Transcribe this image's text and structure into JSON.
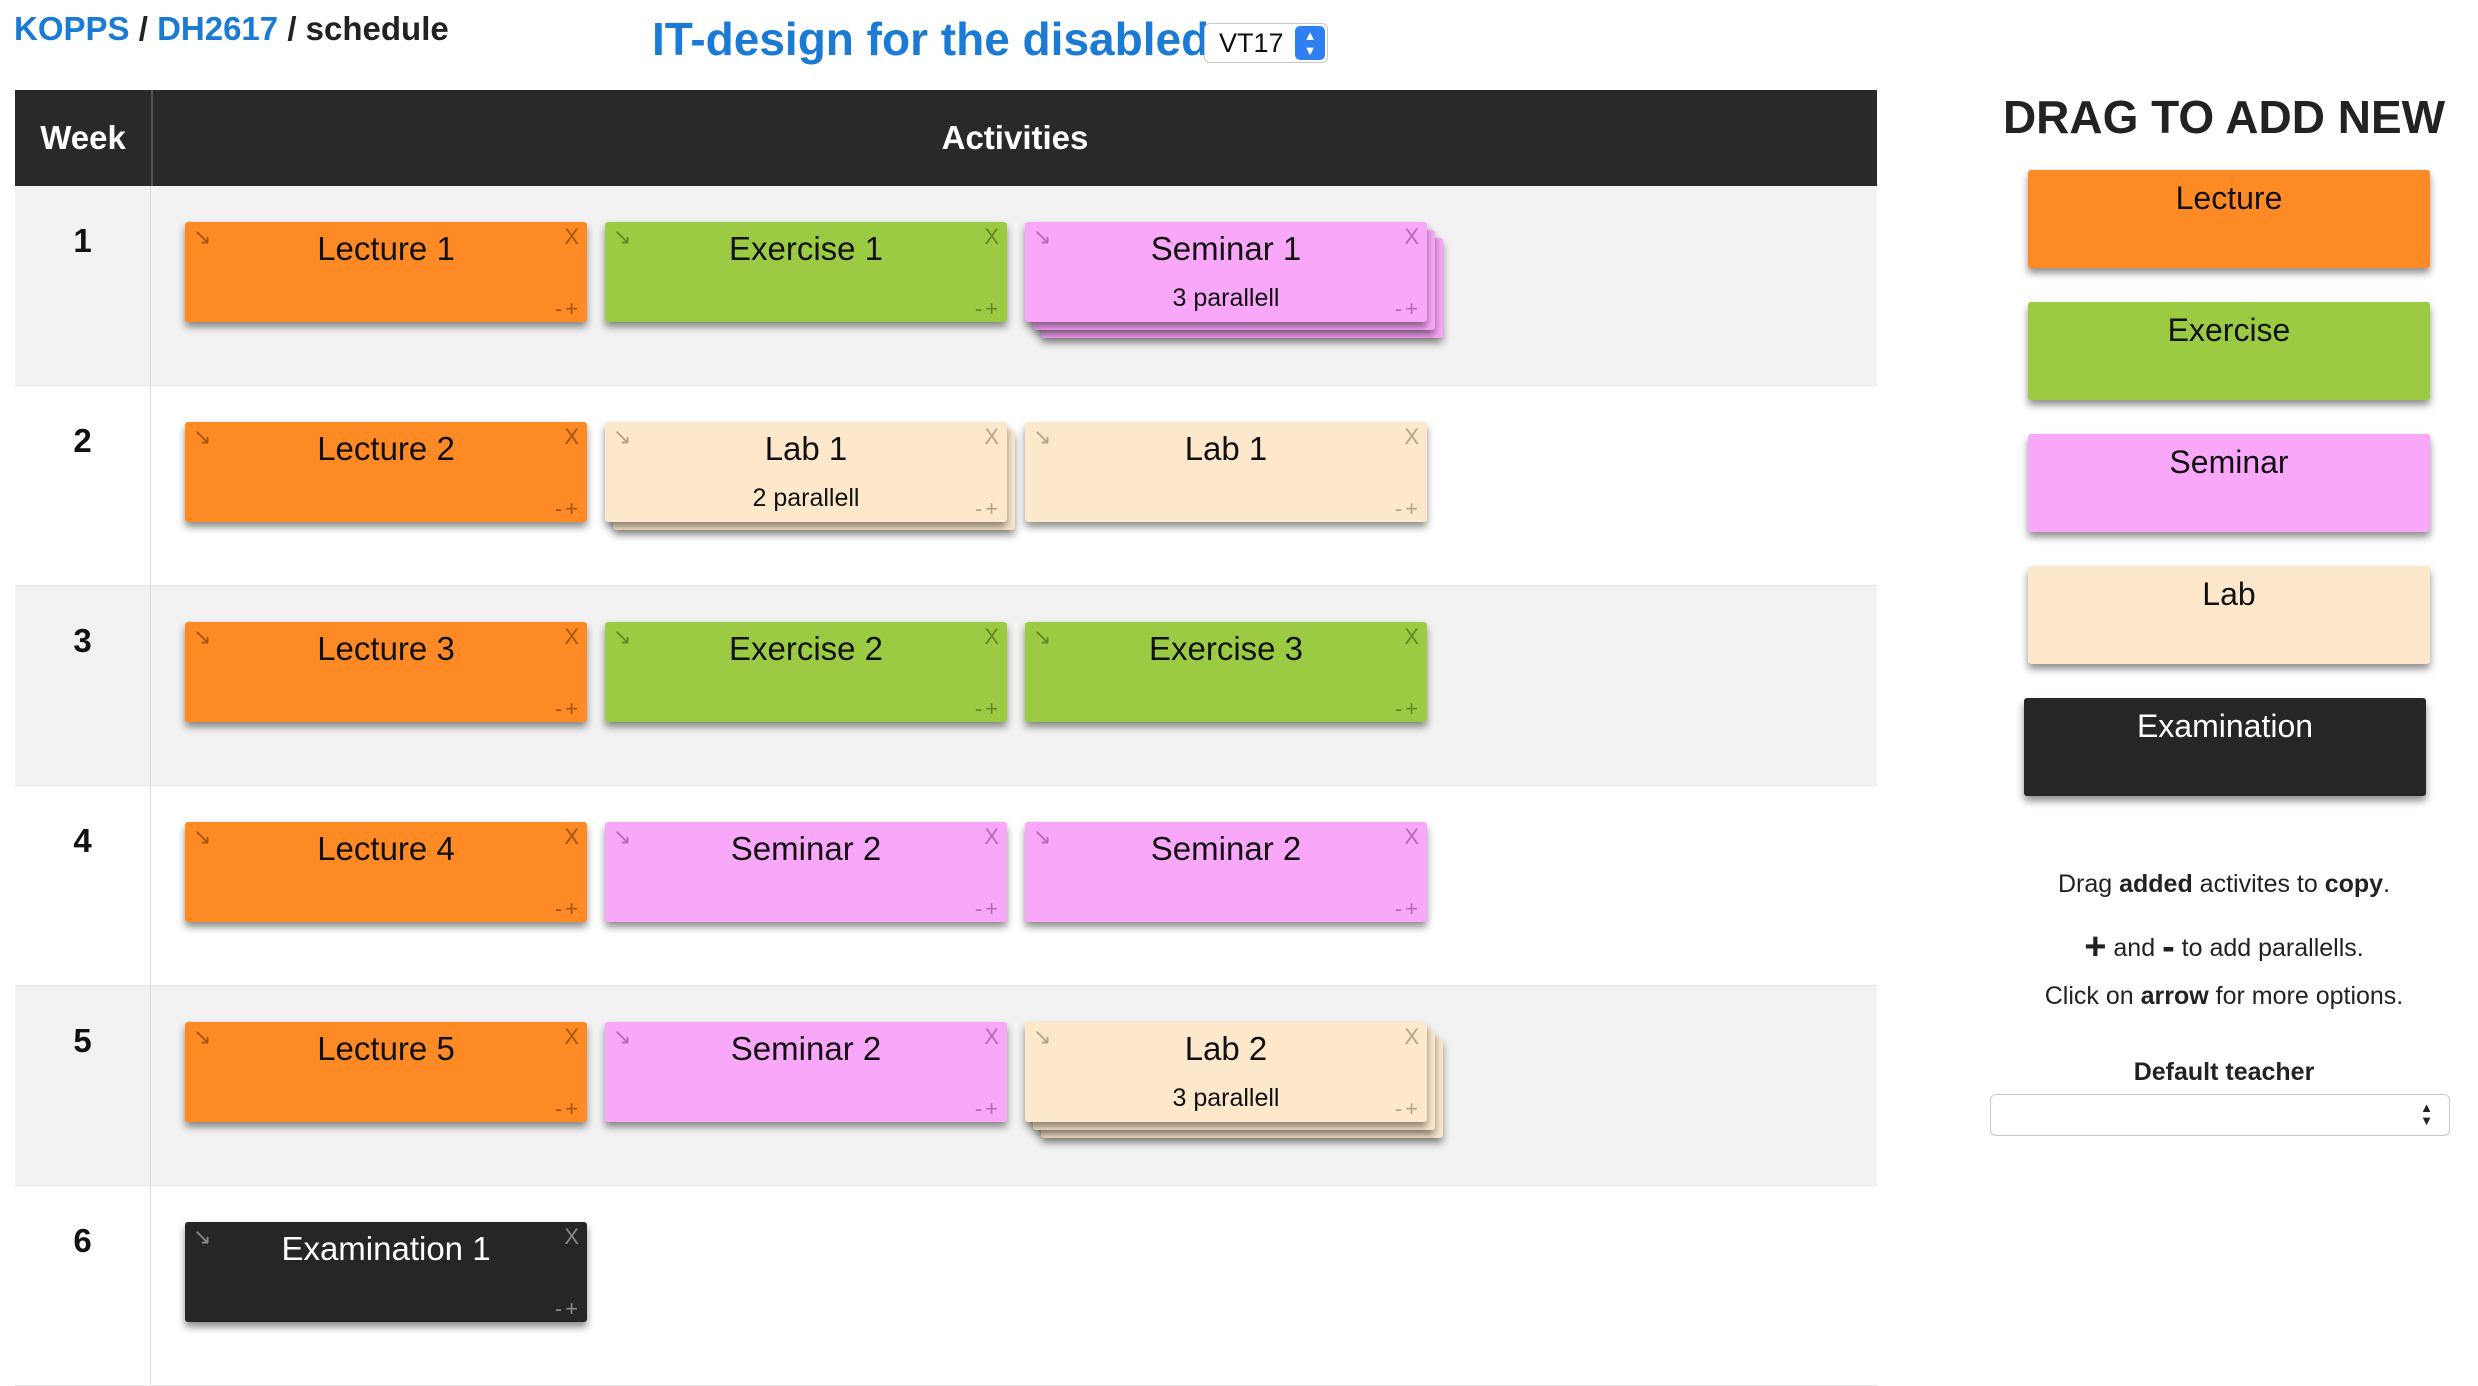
{
  "breadcrumb": {
    "root": "KOPPS",
    "course_code": "DH2617",
    "current": "schedule",
    "separator": "/"
  },
  "course_title": "IT-design for the disabled",
  "term_select": {
    "value": "VT17"
  },
  "table": {
    "week_header": "Week",
    "activities_header": "Activities",
    "weeks": [
      {
        "number": "1",
        "activities": [
          {
            "type": "lecture",
            "name": "Lecture 1",
            "parallel": "",
            "stack": 0
          },
          {
            "type": "exercise",
            "name": "Exercise 1",
            "parallel": "",
            "stack": 0
          },
          {
            "type": "seminar",
            "name": "Seminar 1",
            "parallel": "3 parallell",
            "stack": 2
          }
        ]
      },
      {
        "number": "2",
        "activities": [
          {
            "type": "lecture",
            "name": "Lecture 2",
            "parallel": "",
            "stack": 0
          },
          {
            "type": "lab",
            "name": "Lab 1",
            "parallel": "2 parallell",
            "stack": 1
          },
          {
            "type": "lab",
            "name": "Lab 1",
            "parallel": "",
            "stack": 0
          }
        ]
      },
      {
        "number": "3",
        "activities": [
          {
            "type": "lecture",
            "name": "Lecture 3",
            "parallel": "",
            "stack": 0
          },
          {
            "type": "exercise",
            "name": "Exercise 2",
            "parallel": "",
            "stack": 0
          },
          {
            "type": "exercise",
            "name": "Exercise 3",
            "parallel": "",
            "stack": 0
          }
        ]
      },
      {
        "number": "4",
        "activities": [
          {
            "type": "lecture",
            "name": "Lecture 4",
            "parallel": "",
            "stack": 0
          },
          {
            "type": "seminar",
            "name": "Seminar 2",
            "parallel": "",
            "stack": 0
          },
          {
            "type": "seminar",
            "name": "Seminar 2",
            "parallel": "",
            "stack": 0
          }
        ]
      },
      {
        "number": "5",
        "activities": [
          {
            "type": "lecture",
            "name": "Lecture 5",
            "parallel": "",
            "stack": 0
          },
          {
            "type": "seminar",
            "name": "Seminar 2",
            "parallel": "",
            "stack": 0
          },
          {
            "type": "lab",
            "name": "Lab 2",
            "parallel": "3 parallell",
            "stack": 2
          }
        ]
      },
      {
        "number": "6",
        "activities": [
          {
            "type": "exam",
            "name": "Examination 1",
            "parallel": "",
            "stack": 0
          }
        ]
      }
    ]
  },
  "card_icons": {
    "arrow": "↘",
    "close": "X",
    "minus_plus": "-+"
  },
  "panel": {
    "title": "DRAG TO ADD NEW",
    "templates": [
      {
        "type": "lecture",
        "label": "Lecture"
      },
      {
        "type": "exercise",
        "label": "Exercise"
      },
      {
        "type": "seminar",
        "label": "Seminar"
      },
      {
        "type": "lab",
        "label": "Lab"
      },
      {
        "type": "exam",
        "label": "Examination"
      }
    ],
    "help_line1": {
      "a": "Drag ",
      "b": "added",
      "c": " activites to ",
      "d": "copy",
      "e": "."
    },
    "help_line2": {
      "plus": "+",
      "a": " and ",
      "minus": "-",
      "b": " to add parallells."
    },
    "help_line3": {
      "a": "Click on ",
      "b": "arrow",
      "c": " for more options."
    },
    "default_teacher_label": "Default teacher",
    "default_teacher_value": ""
  },
  "colors": {
    "lecture": "#fd8a25",
    "exercise": "#9bcb43",
    "seminar": "#f9a7f9",
    "lab": "#fde8cc",
    "exam": "#262626",
    "link": "#1a7ad4",
    "header_bg": "#292929"
  }
}
